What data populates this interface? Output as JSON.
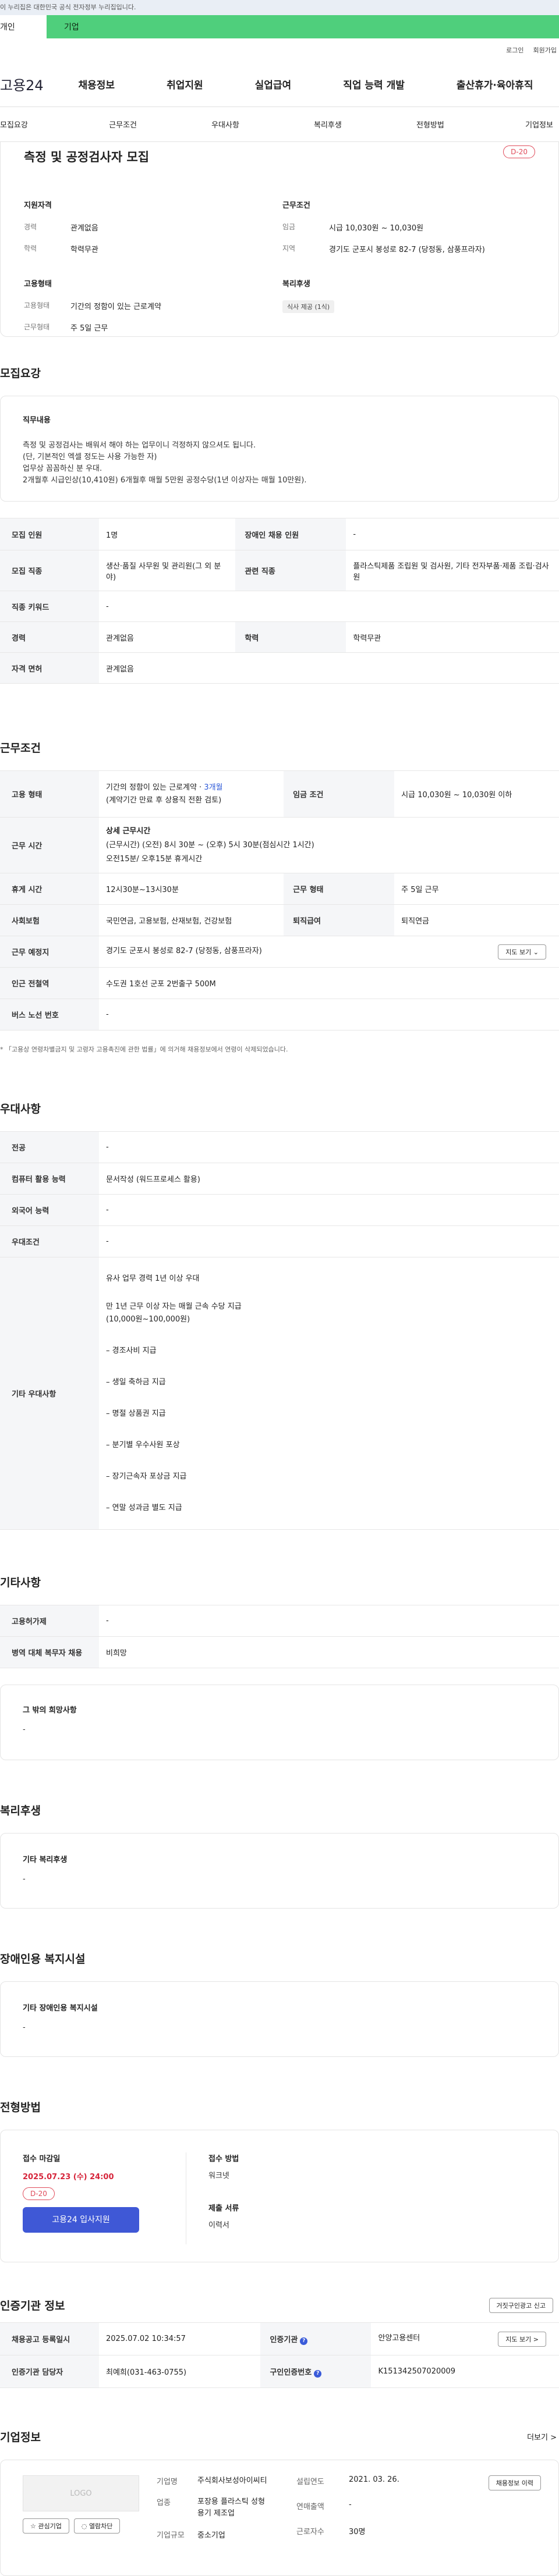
{
  "gov_banner": "이 누리집은 대한민국 공식 전자정부 누리집입니다.",
  "user_tabs": {
    "personal": "개인",
    "company": "기업"
  },
  "util": {
    "login": "로그인",
    "signup": "회원가입"
  },
  "logo": "고용24",
  "gnb": [
    "채용정보",
    "취업지원",
    "실업급여",
    "직업 능력 개발",
    "출산휴가·육아휴직"
  ],
  "subnav": [
    "모집요강",
    "근무조건",
    "우대사항",
    "복리후생",
    "전형방법",
    "기업정보"
  ],
  "summary": {
    "title": "측정 및 공정검사자 모집",
    "dday": "D-20",
    "qual_heading": "지원자격",
    "cond_heading": "근무조건",
    "career_label": "경력",
    "career_value": "관계없음",
    "edu_label": "학력",
    "edu_value": "학력무관",
    "wage_label": "임금",
    "wage_value": "시급 10,030원 ~ 10,030원",
    "region_label": "지역",
    "region_value": "경기도 군포시 봉성로 82-7 (당정동, 삼풍프라자)",
    "emp_heading": "고용형태",
    "emp_label": "고용형태",
    "emp_value": "기간의 정함이 있는 근로계약",
    "work_label": "근무형태",
    "work_value": "주 5일 근무",
    "welfare_heading": "복리후생",
    "welfare_chip": "식사 제공 (1식)"
  },
  "recruit": {
    "title": "모집요강",
    "job_heading": "직무내용",
    "job_lines": [
      "측정 및 공정검사는 배워서 해야 하는 업무이니 걱정하지 않으셔도 됩니다.",
      "(단, 기본적인 엑셀 정도는 사용 가능한 자)",
      "업무상 꼼꼼하신 분 우대.",
      "2개월후 시급인상(10,410원) 6개월후 매월 5만원 공정수당(1년 이상자는 매월 10만원)."
    ],
    "rows": {
      "headcount_label": "모집 인원",
      "headcount_value": "1명",
      "disabled_label": "장애인 채용 인원",
      "disabled_value": "-",
      "job_label": "모집 직종",
      "job_value": "생산·품질 사무원 및 관리원(그 외 분야)",
      "related_label": "관련 직종",
      "related_value": "플라스틱제품 조립원 및 검사원, 기타 전자부품·제품 조립·검사원",
      "keyword_label": "직종 키워드",
      "keyword_value": "-",
      "career_label": "경력",
      "career_value": "관계없음",
      "edu_label": "학력",
      "edu_value": "학력무관",
      "license_label": "자격 면허",
      "license_value": "관계없음"
    }
  },
  "conditions": {
    "title": "근무조건",
    "emp_label": "고용 형태",
    "emp_value_1": "기간의 정함이 있는 근로계약 · ",
    "emp_value_months": "3개월",
    "emp_value_2": "(계약기간 만료 후 상용직 전환 검토)",
    "wage_label": "임금 조건",
    "wage_value": "시급 10,030원 ~ 10,030원 이하",
    "hours_label": "근무 시간",
    "hours_heading": "상세 근무시간",
    "hours_lines": [
      "(근무시간) (오전) 8시 30분 ~ (오후) 5시 30분(점심시간 1시간)",
      "오전15분/ 오후15분 휴게시간"
    ],
    "break_label": "휴게 시간",
    "break_value": "12시30분~13시30분",
    "work_label": "근무 형태",
    "work_value": "주 5일 근무",
    "insurance_label": "사회보험",
    "insurance_value": "국민연금, 고용보험, 산재보험, 건강보험",
    "retire_label": "퇴직급여",
    "retire_value": "퇴직연금",
    "place_label": "근무 예정지",
    "place_value": "경기도 군포시 봉성로 82-7 (당정동, 삼풍프라자)",
    "map_button": "지도 보기 ⌄",
    "station_label": "인근 전철역",
    "station_value": "수도권 1호선 군포 2번출구 500M",
    "bus_label": "버스 노선 번호",
    "bus_value": "-",
    "note": "* 「고용상 연령차별금지 및 고령자 고용촉진에 관한 법률」에 의거해 채용정보에서 연령이 삭제되었습니다."
  },
  "preference": {
    "title": "우대사항",
    "major_label": "전공",
    "major_value": "-",
    "computer_label": "컴퓨터 활용 능력",
    "computer_value": "문서작성 (워드프로세스 활용)",
    "lang_label": "외국어 능력",
    "lang_value": "-",
    "cond_label": "우대조건",
    "cond_value": "-",
    "etc_label": "기타 우대사항",
    "etc_lines": [
      "유사 업무 경력 1년 이상 우대",
      "만 1년 근무 이상 자는 매월 근속 수당 지급",
      "(10,000원~100,000원)",
      "– 경조사비 지급",
      "– 생일 축하금 지급",
      "– 명절 상품권 지급",
      "– 분기별 우수사원 포상",
      "– 장기근속자 포상금 지급",
      "– 연말 성과금 별도 지급"
    ]
  },
  "other": {
    "title": "기타사항",
    "disabled_label": "고용허가제",
    "disabled_value": "-",
    "military_label": "병역 대체 복무자 채용",
    "military_value": "비희망",
    "wish_heading": "그 밖의 희망사항",
    "wish_value": "-"
  },
  "welfare": {
    "title": "복리후생",
    "heading": "기타 복리후생",
    "value": "-"
  },
  "disabled_facility": {
    "title": "장애인용 복지시설",
    "heading": "기타 장애인용 복지시설",
    "value": "-"
  },
  "process": {
    "title": "전형방법",
    "deadline_heading": "접수 마감일",
    "deadline_value": "2025.07.23 (수) 24:00",
    "dday": "D-20",
    "apply_button": "고용24 입사지원",
    "method_heading": "접수 방법",
    "method_value": "워크넷",
    "docs_heading": "제출 서류",
    "docs_value": "이력서"
  },
  "agency": {
    "title": "인증기관 정보",
    "report_button": "거짓구인광고 신고",
    "reg_label": "채용공고 등록일시",
    "reg_value": "2025.07.02 10:34:57",
    "agency_label": "인증기관",
    "agency_value": "안양고용센터",
    "map_button": "지도 보기 >",
    "manager_label": "인증기관 담당자",
    "manager_value": "최예희(031-463-0755)",
    "number_label": "구인인증번호",
    "number_value": "K151342507020009"
  },
  "company": {
    "title": "기업정보",
    "more": "더보기 >",
    "logo_placeholder": "LOGO",
    "interest_button": "☆ 관심기업",
    "block_button": "◌ 열람차단",
    "name_label": "기업명",
    "name_value": "주식회사보성아이씨티",
    "industry_label": "업종",
    "industry_value": "포장용 플라스틱 성형용기 제조업",
    "scale_label": "기업규모",
    "scale_value": "중소기업",
    "founded_label": "설립연도",
    "founded_value": "2021. 03. 26.",
    "revenue_label": "연매출액",
    "revenue_value": "-",
    "employees_label": "근로자수",
    "employees_value": "30명",
    "jobs_button": "채용정보 이력"
  }
}
